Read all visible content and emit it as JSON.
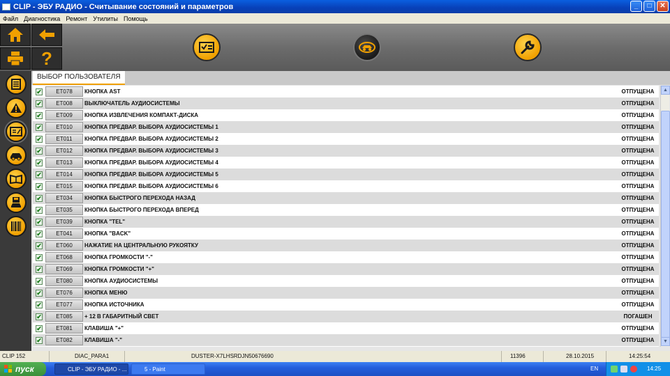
{
  "window": {
    "title": "CLIP - ЭБУ РАДИО - Считывание состояний и параметров",
    "minimize": "_",
    "maximize": "□",
    "close": "✕"
  },
  "menu": [
    "Файл",
    "Диагностика",
    "Ремонт",
    "Утилиты",
    "Помощь"
  ],
  "toolbar": {
    "icons": [
      "home-icon",
      "back-arrow-icon",
      "print-icon",
      "help-icon",
      "checklist-icon",
      "vehicle-scan-icon",
      "wrench-icon"
    ],
    "help_glyph": "?"
  },
  "sidebar": {
    "icons": [
      "document-icon",
      "warning-icon",
      "parameters-icon",
      "vehicle-icon",
      "manual-icon",
      "save-vehicle-icon",
      "barcode-icon"
    ],
    "active_index": 2
  },
  "tab_label": "ВЫБОР ПОЛЬЗОВАТЕЛЯ",
  "rows": [
    {
      "code": "ET078",
      "desc": "КНОПКА AST",
      "state": "ОТПУЩЕНА"
    },
    {
      "code": "ET008",
      "desc": "ВЫКЛЮЧАТЕЛЬ АУДИОСИСТЕМЫ",
      "state": "ОТПУЩЕНА"
    },
    {
      "code": "ET009",
      "desc": "КНОПКА ИЗВЛЕЧЕНИЯ КОМПАКТ-ДИСКА",
      "state": "ОТПУЩЕНА"
    },
    {
      "code": "ET010",
      "desc": "КНОПКА ПРЕДВАР. ВЫБОРА АУДИОСИСТЕМЫ 1",
      "state": "ОТПУЩЕНА"
    },
    {
      "code": "ET011",
      "desc": "КНОПКА ПРЕДВАР. ВЫБОРА АУДИОСИСТЕМЫ 2",
      "state": "ОТПУЩЕНА"
    },
    {
      "code": "ET012",
      "desc": "КНОПКА ПРЕДВАР. ВЫБОРА АУДИОСИСТЕМЫ 3",
      "state": "ОТПУЩЕНА"
    },
    {
      "code": "ET013",
      "desc": "КНОПКА ПРЕДВАР. ВЫБОРА АУДИОСИСТЕМЫ 4",
      "state": "ОТПУЩЕНА"
    },
    {
      "code": "ET014",
      "desc": "КНОПКА ПРЕДВАР. ВЫБОРА АУДИОСИСТЕМЫ 5",
      "state": "ОТПУЩЕНА"
    },
    {
      "code": "ET015",
      "desc": "КНОПКА ПРЕДВАР. ВЫБОРА АУДИОСИСТЕМЫ 6",
      "state": "ОТПУЩЕНА"
    },
    {
      "code": "ET034",
      "desc": "КНОПКА БЫСТРОГО ПЕРЕХОДА НАЗАД",
      "state": "ОТПУЩЕНА"
    },
    {
      "code": "ET035",
      "desc": "КНОПКА БЫСТРОГО ПЕРЕХОДА ВПЕРЕД",
      "state": "ОТПУЩЕНА"
    },
    {
      "code": "ET039",
      "desc": "КНОПКА \"TEL\"",
      "state": "ОТПУЩЕНА"
    },
    {
      "code": "ET041",
      "desc": "КНОПКА \"BACK\"",
      "state": "ОТПУЩЕНА"
    },
    {
      "code": "ET060",
      "desc": "НАЖАТИЕ НА ЦЕНТРАЛЬНУЮ РУКОЯТКУ",
      "state": "ОТПУЩЕНА"
    },
    {
      "code": "ET068",
      "desc": "КНОПКА ГРОМКОСТИ \"-\"",
      "state": "ОТПУЩЕНА"
    },
    {
      "code": "ET069",
      "desc": "КНОПКА ГРОМКОСТИ \"+\"",
      "state": "ОТПУЩЕНА"
    },
    {
      "code": "ET080",
      "desc": "КНОПКА АУДИОСИСТЕМЫ",
      "state": "ОТПУЩЕНА"
    },
    {
      "code": "ET076",
      "desc": "КНОПКА МЕНЮ",
      "state": "ОТПУЩЕНА"
    },
    {
      "code": "ET077",
      "desc": "КНОПКА ИСТОЧНИКА",
      "state": "ОТПУЩЕНА"
    },
    {
      "code": "ET085",
      "desc": "+ 12 В ГАБАРИТНЫЙ СВЕТ",
      "state": "ПОГАШЕН"
    },
    {
      "code": "ET081",
      "desc": "КЛАВИША \"+\"",
      "state": "ОТПУЩЕНА"
    },
    {
      "code": "ET082",
      "desc": "КЛАВИША \"-\"",
      "state": "ОТПУЩЕНА"
    }
  ],
  "checkmark": "✔",
  "status": {
    "version": "CLIP 152",
    "config": "DIAC_PARA1",
    "vin": "DUSTER-X7LHSRDJN50676690",
    "code": "11396",
    "date": "28.10.2015",
    "time": "14:25:54"
  },
  "taskbar": {
    "start_label": "пуск",
    "tasks": [
      "CLIP - ЭБУ РАДИО - ...",
      "5 - Paint"
    ],
    "language": "EN",
    "clock": "14:25"
  },
  "colors": {
    "accent": "#f0a000",
    "title_bar": "#0a5fe0",
    "row_alt": "#dcdcdc"
  }
}
